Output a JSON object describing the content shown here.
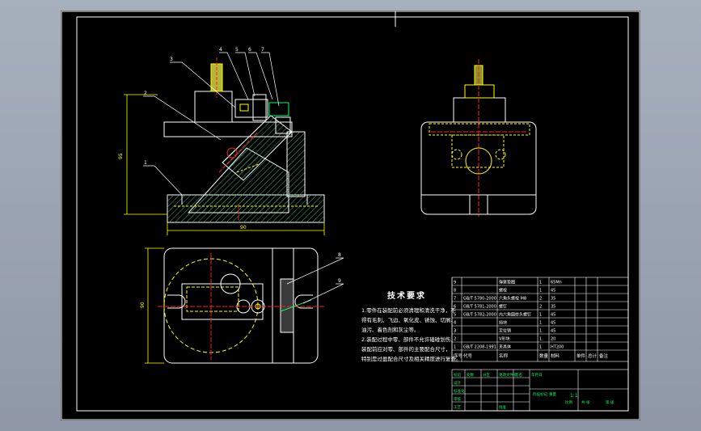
{
  "window": {
    "title": "",
    "background": "#98a1af"
  },
  "sheet": {
    "background": "#000000",
    "border_color": "#ffffff"
  },
  "colors": {
    "outline": "#ffffff",
    "hidden": "#ffff00",
    "center": "#ff2020",
    "hatch": "#3cb371",
    "accent": "#00ff66",
    "dim": "#ffff00",
    "text": "#ffffff"
  },
  "drawing": {
    "front_view": {
      "leaders": [
        "1",
        "2",
        "3",
        "4",
        "5",
        "6",
        "7"
      ],
      "dimensions": {
        "height": "95",
        "width": "90"
      }
    },
    "side_view": {},
    "top_view": {
      "leaders": [
        "8",
        "9"
      ],
      "dimensions": {
        "height": "90"
      }
    }
  },
  "tech_requirements": {
    "title": "技术要求",
    "lines": [
      "1.零件在装配前必须清理和清洗干净，不",
      "得有毛刺、飞边、氧化皮、锈蚀、切屑、",
      "油污、着色剂和灰尘等。",
      "2.装配过程中零、部件不允许磕碰划伤，",
      "装配前应对零、部件的主要配合尺寸，",
      "特别是过盈配合尺寸及相关精度进行复查。"
    ]
  },
  "bom": {
    "header": [
      "序号",
      "代号",
      "名称",
      "数量",
      "材料",
      "单件",
      "总计",
      "备注"
    ],
    "rows": [
      [
        "9",
        "",
        "弹簧垫圈",
        "1",
        "65Mn",
        "",
        "",
        ""
      ],
      [
        "8",
        "",
        "螺栓",
        "1",
        "45",
        "",
        "",
        ""
      ],
      [
        "7",
        "GB/T 5780-2000",
        "六角头螺栓 M8",
        "2",
        "35",
        "",
        "",
        ""
      ],
      [
        "6",
        "GB/T 5781-2000",
        "螺钉",
        "2",
        "35",
        "",
        "",
        ""
      ],
      [
        "5",
        "GB/T 5782-2000",
        "内六角圆柱头螺钉",
        "1",
        "45",
        "",
        "",
        ""
      ],
      [
        "4",
        "",
        "挡块",
        "1",
        "45",
        "",
        "",
        ""
      ],
      [
        "3",
        "",
        "定位销",
        "1",
        "45",
        "",
        "",
        ""
      ],
      [
        "2",
        "",
        "V形块",
        "1",
        "20",
        "",
        "",
        ""
      ],
      [
        "1",
        "GB/T 2208-1991",
        "夹具体",
        "1",
        "HT200",
        "",
        "",
        ""
      ]
    ]
  },
  "title_block": {
    "labels": [
      "标记",
      "处数",
      "分区",
      "更改文件号",
      "签名",
      "年月日",
      "设计",
      "标准化",
      "审核",
      "工艺",
      "批准",
      "阶段标记",
      "重量",
      "比例",
      "共 张",
      "第 张"
    ],
    "scale": "1:1"
  }
}
